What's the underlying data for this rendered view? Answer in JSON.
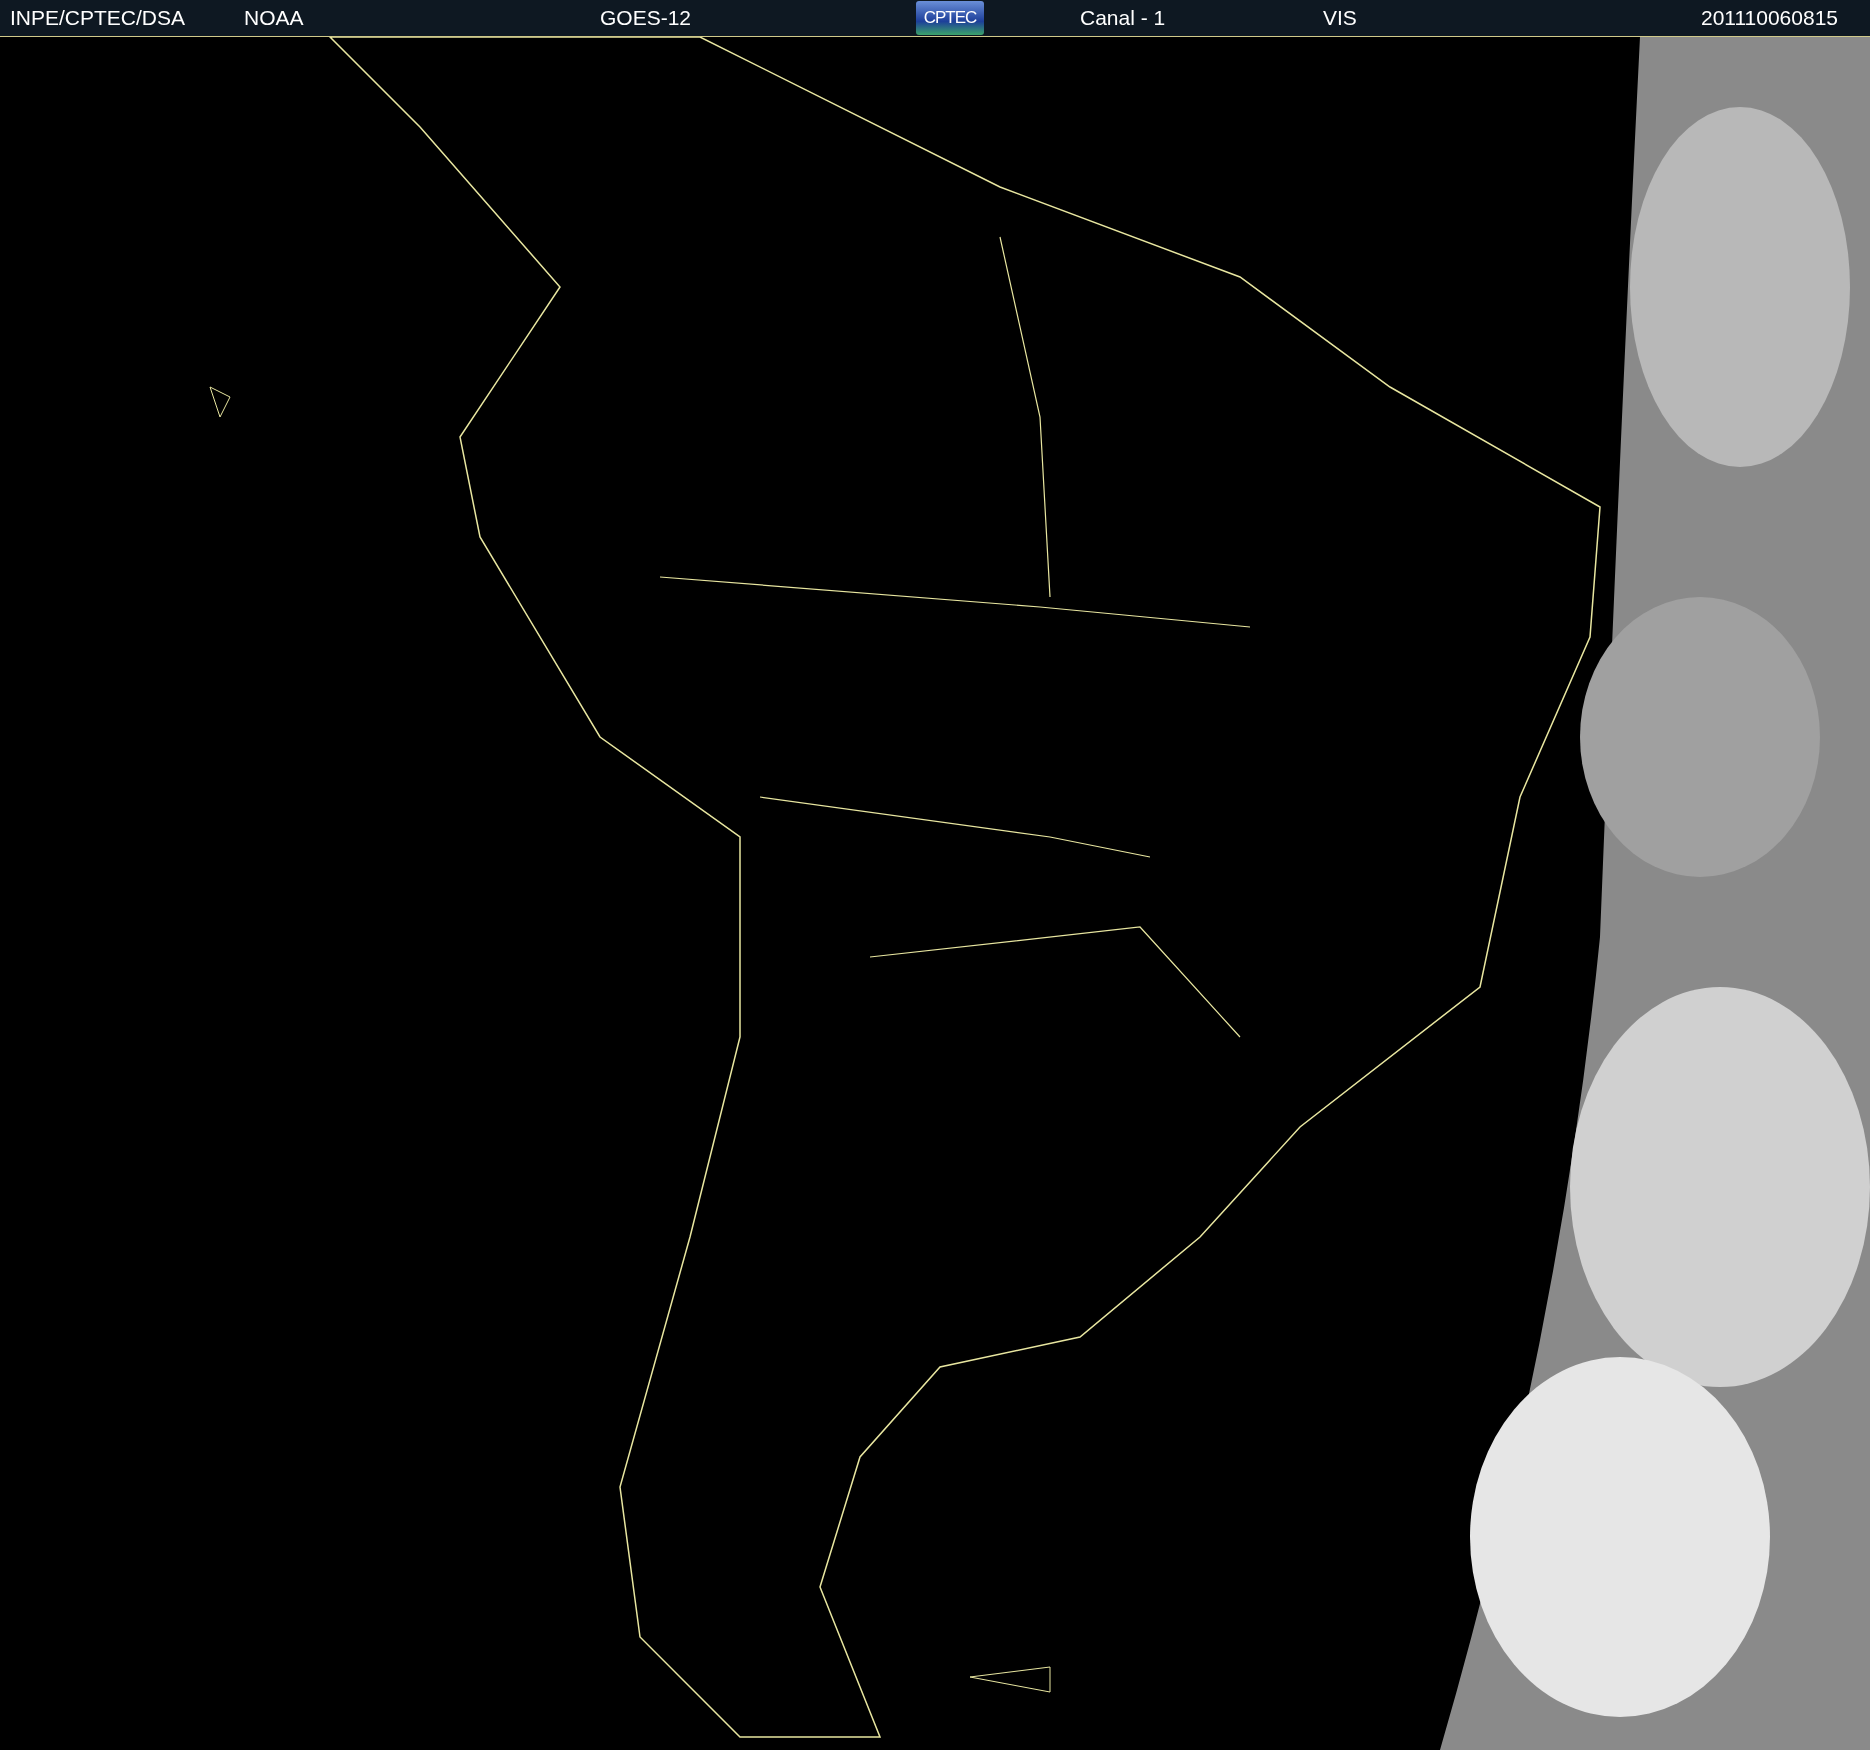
{
  "header": {
    "source": "INPE/CPTEC/DSA",
    "agency": "NOAA",
    "satellite": "GOES-12",
    "logo": "CPTEC",
    "channel": "Canal - 1",
    "band": "VIS",
    "timestamp": "201110060815"
  }
}
